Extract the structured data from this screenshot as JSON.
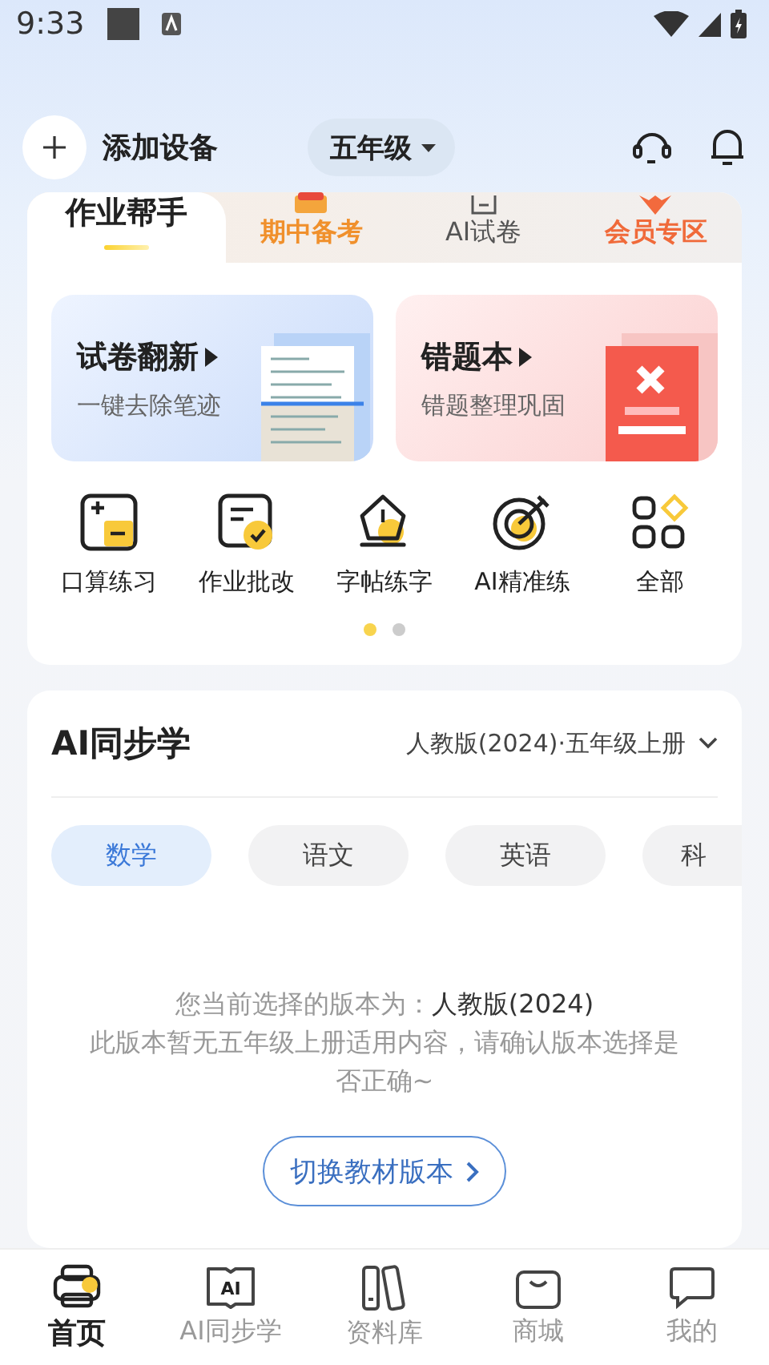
{
  "status_bar": {
    "time": "9:33"
  },
  "header": {
    "add_device": "添加设备",
    "grade": "五年级"
  },
  "tabs": [
    {
      "label": "作业帮手",
      "selected": true,
      "kind": "home"
    },
    {
      "label": "期中备考",
      "selected": false,
      "kind": "exam"
    },
    {
      "label": "AI试卷",
      "selected": false,
      "kind": "paper"
    },
    {
      "label": "会员专区",
      "selected": false,
      "kind": "vip"
    }
  ],
  "promos": [
    {
      "title": "试卷翻新",
      "subtitle": "一键去除笔迹",
      "kind": "paper"
    },
    {
      "title": "错题本",
      "subtitle": "错题整理巩固",
      "kind": "mistakes"
    }
  ],
  "tools": [
    {
      "label": "口算练习",
      "kind": "math"
    },
    {
      "label": "作业批改",
      "kind": "check"
    },
    {
      "label": "字帖练字",
      "kind": "pen"
    },
    {
      "label": "AI精准练",
      "kind": "target"
    },
    {
      "label": "全部",
      "kind": "all"
    }
  ],
  "pager": [
    {
      "selected": true
    },
    {
      "selected": false
    }
  ],
  "sync": {
    "title": "AI同步学",
    "edition": "人教版(2024)·五年级上册",
    "subjects": [
      {
        "label": "数学",
        "selected": true
      },
      {
        "label": "语文",
        "selected": false
      },
      {
        "label": "英语",
        "selected": false
      },
      {
        "label": "科",
        "selected": false
      }
    ],
    "notice_lead": "您当前选择的版本为：",
    "notice_edition": "人教版(2024)",
    "notice_body": "此版本暂无五年级上册适用内容，请确认版本选择是否正确~",
    "switch_button": "切换教材版本"
  },
  "nav": [
    {
      "label": "首页",
      "selected": true,
      "kind": "home"
    },
    {
      "label": "AI同步学",
      "selected": false,
      "kind": "ai",
      "badge": "AI"
    },
    {
      "label": "资料库",
      "selected": false,
      "kind": "library"
    },
    {
      "label": "商城",
      "selected": false,
      "kind": "store"
    },
    {
      "label": "我的",
      "selected": false,
      "kind": "me"
    }
  ]
}
